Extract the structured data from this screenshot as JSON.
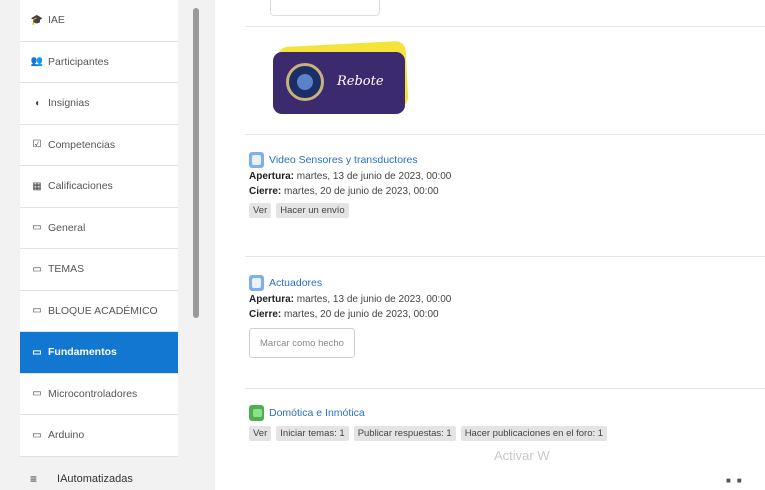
{
  "sidebar": {
    "items": [
      {
        "icon": "graduation-cap-icon",
        "glyph": "🎓",
        "label": "IAE",
        "active": false
      },
      {
        "icon": "users-icon",
        "glyph": "👥",
        "label": "Participantes",
        "active": false
      },
      {
        "icon": "shield-icon",
        "glyph": "◖",
        "label": "Insignias",
        "active": false
      },
      {
        "icon": "checkbox-icon",
        "glyph": "☑",
        "label": "Competencias",
        "active": false
      },
      {
        "icon": "grades-table-icon",
        "glyph": "▦",
        "label": "Calificaciones",
        "active": false
      },
      {
        "icon": "folder-icon",
        "glyph": "▭",
        "label": "General",
        "active": false
      },
      {
        "icon": "folder-icon",
        "glyph": "▭",
        "label": "TEMAS",
        "active": false
      },
      {
        "icon": "folder-icon",
        "glyph": "▭",
        "label": "BLOQUE ACADÉMICO",
        "active": false
      },
      {
        "icon": "folder-icon",
        "glyph": "▭",
        "label": "Fundamentos",
        "active": true
      },
      {
        "icon": "folder-icon",
        "glyph": "▭",
        "label": "Microcontroladores",
        "active": false
      },
      {
        "icon": "folder-icon",
        "glyph": "▭",
        "label": "Arduino",
        "active": false
      }
    ],
    "bottom_icon": "≡",
    "bottom_label": "IAutomatizadas"
  },
  "main": {
    "banner_text": "Rebote",
    "activities": [
      {
        "title": "Video Sensores y transductores",
        "opening_label": "Apertura:",
        "opening_value": "martes, 13 de junio de 2023, 00:00",
        "closing_label": "Cierre:",
        "closing_value": "martes, 20 de junio de 2023, 00:00",
        "chips": [
          "Ver",
          "Hacer un envío"
        ]
      },
      {
        "title": "Actuadores",
        "opening_label": "Apertura:",
        "opening_value": "martes, 13 de junio de 2023, 00:00",
        "closing_label": "Cierre:",
        "closing_value": "martes, 20 de junio de 2023, 00:00",
        "button": "Marcar como hecho"
      },
      {
        "title": "Domótica e Inmótica",
        "chips": [
          "Ver",
          "Iniciar temas: 1",
          "Publicar respuestas: 1",
          "Hacer publicaciones en el foro: 1"
        ]
      }
    ]
  },
  "watermark": "Activar W",
  "colors": {
    "accent": "#1177d1",
    "banner_bg": "#3c2a6e",
    "banner_glow": "#f5e33b",
    "link": "#2a6fc0"
  }
}
